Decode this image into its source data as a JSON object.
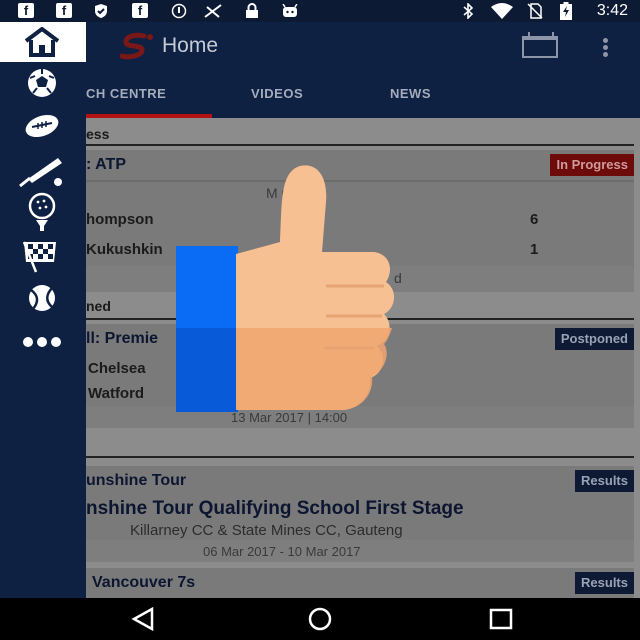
{
  "status_bar": {
    "time": "3:42",
    "left_icons": [
      "facebook-icon",
      "facebook-icon",
      "shield-icon",
      "facebook-icon",
      "info-icon",
      "no-signal-icon",
      "lock-icon",
      "android-icon"
    ],
    "right_icons": [
      "bluetooth-icon",
      "wifi-icon",
      "no-sim-icon",
      "battery-charging-icon"
    ]
  },
  "app_bar": {
    "title": "Home",
    "tabs": [
      {
        "label": "CH CENTRE",
        "selected": true
      },
      {
        "label": "VIDEOS",
        "selected": false
      },
      {
        "label": "NEWS",
        "selected": false
      }
    ]
  },
  "sections": {
    "in_progress": {
      "header": "ess",
      "card": {
        "title": ": ATP",
        "status": "In Progress",
        "event": "M        ngles",
        "players": [
          {
            "name": "hompson",
            "score": "6"
          },
          {
            "name": "Kukushkin",
            "score": "1"
          }
        ],
        "footer": "d"
      }
    },
    "postponed": {
      "header": "ned",
      "card": {
        "title": "ll: Premie",
        "status": "Postponed",
        "teams": [
          "Chelsea",
          "Watford"
        ],
        "date": "13 Mar 2017  |  14:00"
      }
    },
    "results": {
      "cards": [
        {
          "title": "unshine Tour",
          "status": "Results",
          "event": "nshine Tour Qualifying School First Stage",
          "venue": "Killarney CC & State Mines CC, Gauteng",
          "date": "06 Mar 2017  -  10 Mar 2017"
        },
        {
          "title": "Vancouver 7s",
          "status": "Results"
        }
      ]
    }
  },
  "drawer": {
    "items": [
      "home-icon",
      "soccer-icon",
      "rugby-icon",
      "cricket-icon",
      "golf-icon",
      "motorsport-icon",
      "tennis-icon",
      "more-icon"
    ]
  },
  "colors": {
    "navy": "#0e2143",
    "accent_red": "#b31212",
    "thumb_skin": "#f6b385",
    "cuff_blue": "#0a6cf5"
  }
}
